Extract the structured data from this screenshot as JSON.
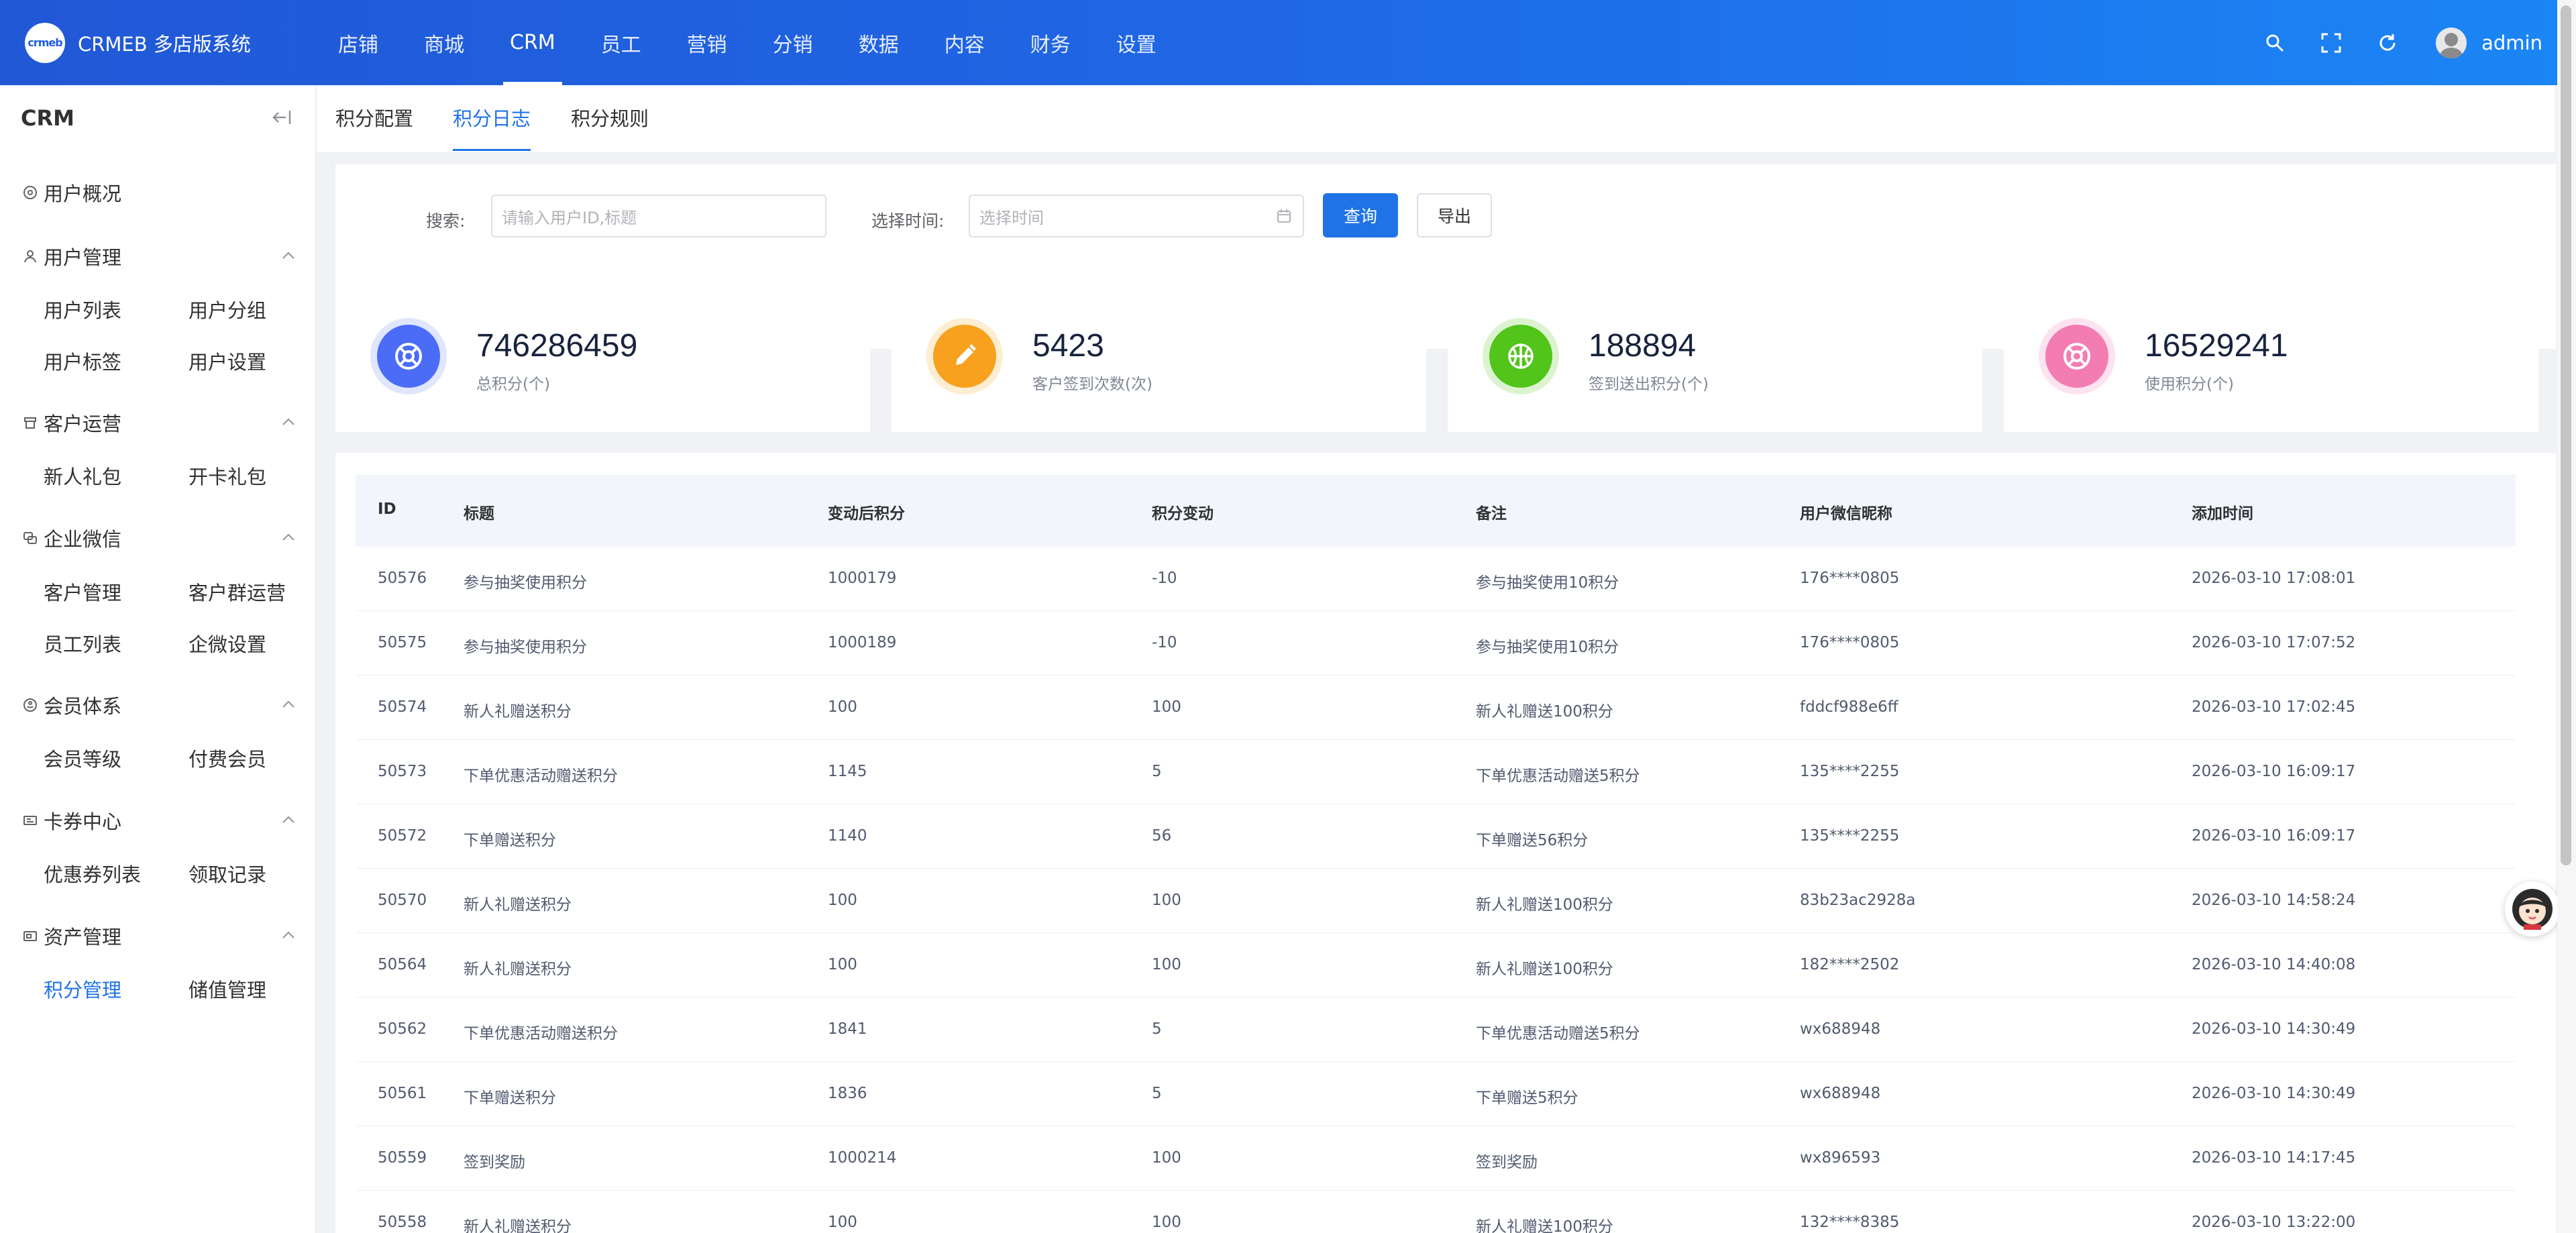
{
  "app": {
    "title": "CRMEB 多店版系统",
    "logo_text": "crmeb"
  },
  "topnav": [
    {
      "label": "店铺"
    },
    {
      "label": "商城"
    },
    {
      "label": "CRM"
    },
    {
      "label": "员工"
    },
    {
      "label": "营销"
    },
    {
      "label": "分销"
    },
    {
      "label": "数据"
    },
    {
      "label": "内容"
    },
    {
      "label": "财务"
    },
    {
      "label": "设置"
    }
  ],
  "user": {
    "name": "admin"
  },
  "sidebar": {
    "title": "CRM",
    "groups": [
      {
        "label": "用户概况",
        "icon": "overview-icon",
        "items": []
      },
      {
        "label": "用户管理",
        "icon": "user-icon",
        "items": [
          "用户列表",
          "用户分组",
          "用户标签",
          "用户设置"
        ]
      },
      {
        "label": "客户运营",
        "icon": "operation-icon",
        "items": [
          "新人礼包",
          "开卡礼包"
        ]
      },
      {
        "label": "企业微信",
        "icon": "wechat-work-icon",
        "items": [
          "客户管理",
          "客户群运营",
          "员工列表",
          "企微设置"
        ]
      },
      {
        "label": "会员体系",
        "icon": "member-icon",
        "items": [
          "会员等级",
          "付费会员"
        ]
      },
      {
        "label": "卡券中心",
        "icon": "card-icon",
        "items": [
          "优惠券列表",
          "领取记录"
        ]
      },
      {
        "label": "资产管理",
        "icon": "asset-icon",
        "items": [
          "积分管理",
          "储值管理"
        ]
      }
    ],
    "active_item": "积分管理"
  },
  "tabs": [
    {
      "label": "积分配置"
    },
    {
      "label": "积分日志"
    },
    {
      "label": "积分规则"
    }
  ],
  "search": {
    "label": "搜索:",
    "placeholder": "请输入用户ID,标题",
    "time_label": "选择时间:",
    "time_placeholder": "选择时间",
    "query_button": "查询",
    "export_button": "导出"
  },
  "stats": [
    {
      "value": "746286459",
      "label": "总积分(个)",
      "color": "#4a6cf7",
      "ring": "#dfe6fd",
      "icon": "lifebuoy-icon"
    },
    {
      "value": "5423",
      "label": "客户签到次数(次)",
      "color": "#f7a11e",
      "ring": "#fdedd2",
      "icon": "pencil-icon"
    },
    {
      "value": "188894",
      "label": "签到送出积分(个)",
      "color": "#52c41a",
      "ring": "#dcf3d0",
      "icon": "basketball-icon"
    },
    {
      "value": "16529241",
      "label": "使用积分(个)",
      "color": "#f37cb3",
      "ring": "#fde3ef",
      "icon": "lifebuoy-icon"
    }
  ],
  "table": {
    "headers": [
      "ID",
      "标题",
      "变动后积分",
      "积分变动",
      "备注",
      "用户微信昵称",
      "添加时间"
    ],
    "rows": [
      [
        "50576",
        "参与抽奖使用积分",
        "1000179",
        "-10",
        "参与抽奖使用10积分",
        "176****0805",
        "2026-03-10 17:08:01"
      ],
      [
        "50575",
        "参与抽奖使用积分",
        "1000189",
        "-10",
        "参与抽奖使用10积分",
        "176****0805",
        "2026-03-10 17:07:52"
      ],
      [
        "50574",
        "新人礼赠送积分",
        "100",
        "100",
        "新人礼赠送100积分",
        "fddcf988e6ff",
        "2026-03-10 17:02:45"
      ],
      [
        "50573",
        "下单优惠活动赠送积分",
        "1145",
        "5",
        "下单优惠活动赠送5积分",
        "135****2255",
        "2026-03-10 16:09:17"
      ],
      [
        "50572",
        "下单赠送积分",
        "1140",
        "56",
        "下单赠送56积分",
        "135****2255",
        "2026-03-10 16:09:17"
      ],
      [
        "50570",
        "新人礼赠送积分",
        "100",
        "100",
        "新人礼赠送100积分",
        "83b23ac2928a",
        "2026-03-10 14:58:24"
      ],
      [
        "50564",
        "新人礼赠送积分",
        "100",
        "100",
        "新人礼赠送100积分",
        "182****2502",
        "2026-03-10 14:40:08"
      ],
      [
        "50562",
        "下单优惠活动赠送积分",
        "1841",
        "5",
        "下单优惠活动赠送5积分",
        "wx688948",
        "2026-03-10 14:30:49"
      ],
      [
        "50561",
        "下单赠送积分",
        "1836",
        "5",
        "下单赠送5积分",
        "wx688948",
        "2026-03-10 14:30:49"
      ],
      [
        "50559",
        "签到奖励",
        "1000214",
        "100",
        "签到奖励",
        "wx896593",
        "2026-03-10 14:17:45"
      ],
      [
        "50558",
        "新人礼赠送积分",
        "100",
        "100",
        "新人礼赠送100积分",
        "132****8385",
        "2026-03-10 13:22:00"
      ]
    ]
  }
}
